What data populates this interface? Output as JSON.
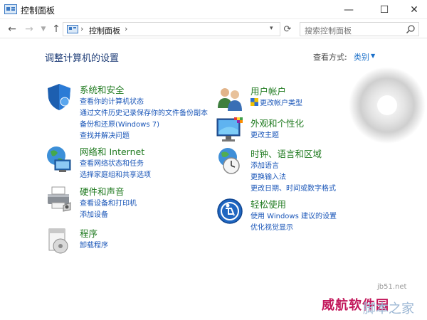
{
  "window": {
    "title": "控制面板",
    "min": "—",
    "max": "☐",
    "close": "✕"
  },
  "nav": {
    "back": "←",
    "forward": "→",
    "recent": "▼",
    "up": "↑",
    "address_sep": "›",
    "address_text": "控制面板",
    "address_dropdown": "▾",
    "refresh": "⟳",
    "search_placeholder": "搜索控制面板"
  },
  "header": {
    "title": "调整计算机的设置",
    "view_label": "查看方式:",
    "view_value": "类别",
    "view_arrow": "▼"
  },
  "left": [
    {
      "title": "系统和安全",
      "links": [
        "查看你的计算机状态",
        "通过文件历史记录保存你的文件备份副本",
        "备份和还原(Windows 7)",
        "查找并解决问题"
      ]
    },
    {
      "title": "网络和 Internet",
      "links": [
        "查看网络状态和任务",
        "选择家庭组和共享选项"
      ]
    },
    {
      "title": "硬件和声音",
      "links": [
        "查看设备和打印机",
        "添加设备"
      ]
    },
    {
      "title": "程序",
      "links": [
        "卸载程序"
      ]
    }
  ],
  "right": [
    {
      "title": "用户帐户",
      "links": [
        "更改帐户类型"
      ]
    },
    {
      "title": "外观和个性化",
      "links": [
        "更改主题"
      ]
    },
    {
      "title": "时钟、语言和区域",
      "links": [
        "添加语言",
        "更换输入法",
        "更改日期、时间或数字格式"
      ]
    },
    {
      "title": "轻松使用",
      "links": [
        "使用 Windows 建议的设置",
        "优化视觉显示"
      ]
    }
  ],
  "watermark": {
    "red": "威航软件园",
    "blue": "脚本之家",
    "small": "jb51.net"
  }
}
